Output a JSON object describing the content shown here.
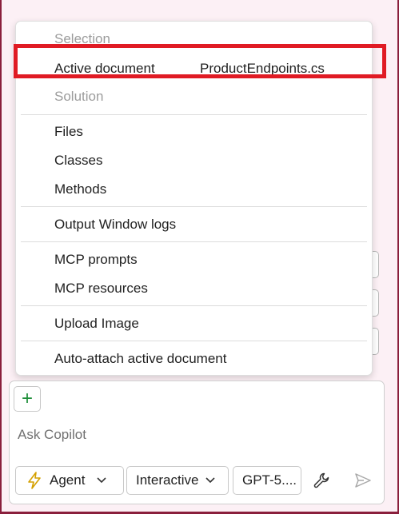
{
  "menu": {
    "selection_header": "Selection",
    "active_document_label": "Active document",
    "active_document_file": "ProductEndpoints.cs",
    "solution_header": "Solution",
    "items": {
      "files": "Files",
      "classes": "Classes",
      "methods": "Methods",
      "output_window_logs": "Output Window logs",
      "mcp_prompts": "MCP prompts",
      "mcp_resources": "MCP resources",
      "upload_image": "Upload Image",
      "auto_attach": "Auto-attach active document"
    }
  },
  "chat": {
    "add_button": "+",
    "placeholder": "Ask Copilot",
    "mode": "Agent",
    "style": "Interactive",
    "model": "GPT-5....",
    "tools_icon": "wrench-icon",
    "send_icon": "send-icon"
  },
  "colors": {
    "highlight": "#e01b24",
    "agent_icon": "#d4a000",
    "plus": "#1f8f3a"
  }
}
